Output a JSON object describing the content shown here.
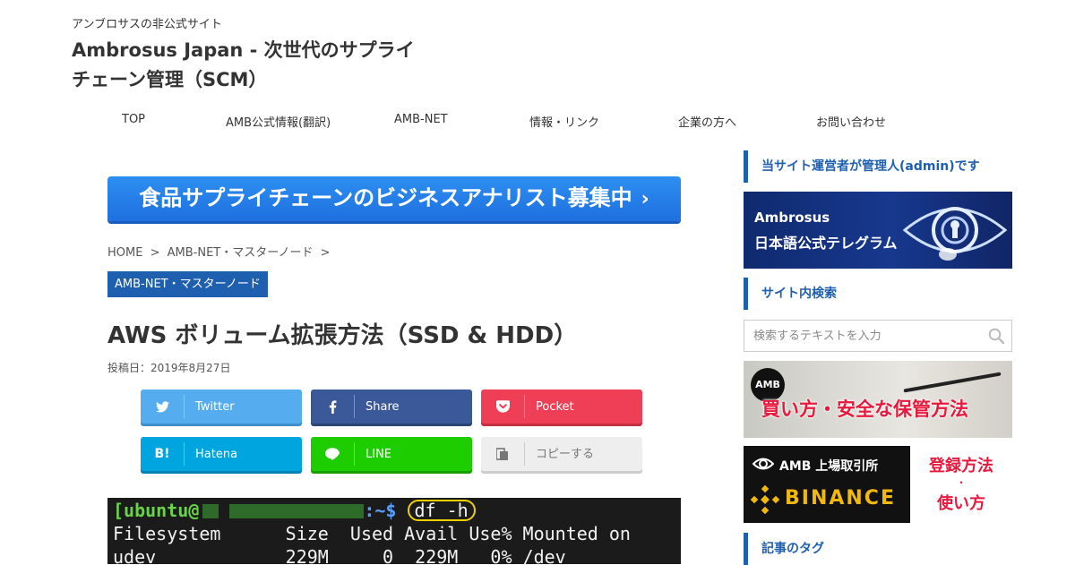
{
  "header": {
    "tagline": "アンブロサスの非公式サイト",
    "site_title_line1": "Ambrosus Japan - 次世代のサプライ",
    "site_title_line2": "チェーン管理（SCM）"
  },
  "nav": {
    "items": [
      {
        "label": "TOP"
      },
      {
        "label": "AMB公式情報(翻訳)"
      },
      {
        "label": "AMB-NET"
      },
      {
        "label": "情報・リンク"
      },
      {
        "label": "企業の方へ"
      },
      {
        "label": "お問い合わせ"
      }
    ]
  },
  "banner": {
    "text": "食品サプライチェーンのビジネスアナリスト募集中",
    "chevron": "›",
    "color": "#2d8ff0"
  },
  "breadcrumb": {
    "items": [
      "HOME",
      "AMB-NET・マスターノード"
    ],
    "separator": ">"
  },
  "article": {
    "category": "AMB-NET・マスターノード",
    "title": "AWS ボリューム拡張方法（SSD & HDD）",
    "date": "投稿日：2019年8月27日"
  },
  "share": {
    "twitter": {
      "label": "Twitter",
      "color": "#55acee",
      "icon": "twitter-bird-icon"
    },
    "facebook": {
      "label": "Share",
      "color": "#3b5998",
      "icon": "facebook-icon"
    },
    "pocket": {
      "label": "Pocket",
      "color": "#ef3f56",
      "icon": "pocket-icon"
    },
    "hatena": {
      "label": "Hatena",
      "icon_text": "B!",
      "color": "#00a4de"
    },
    "line": {
      "label": "LINE",
      "color": "#1dcd00",
      "icon": "line-chat-icon"
    },
    "copy": {
      "label": "コピーする",
      "color": "#eeeeee",
      "icon": "copy-icon"
    }
  },
  "terminal": {
    "prompt_user": "[ubuntu@",
    "prompt_path": ":~$",
    "command": "df -h",
    "header_row": "Filesystem      Size  Used Avail Use% Mounted on",
    "row1": "udev            229M     0  229M   0% /dev"
  },
  "sidebar": {
    "admin_title": "当サイト運営者が管理人(admin)です",
    "telegram_banner": {
      "line1": "Ambrosus",
      "line2": "日本語公式テレグラム"
    },
    "search_title": "サイト内検索",
    "search_placeholder": "検索するテキストを入力",
    "buy_banner": {
      "badge": "AMB",
      "text": "買い方・安全な保管方法"
    },
    "binance_banner": {
      "exchange": "AMB 上場取引所",
      "logo": "BINANCE",
      "register": "登録方法",
      "dot": "・",
      "usage": "使い方"
    },
    "tags_title": "記事のタグ"
  },
  "colors": {
    "accent": "#1f5fb0",
    "binance_yellow": "#f0b90b",
    "alert_red": "#e8193c"
  }
}
